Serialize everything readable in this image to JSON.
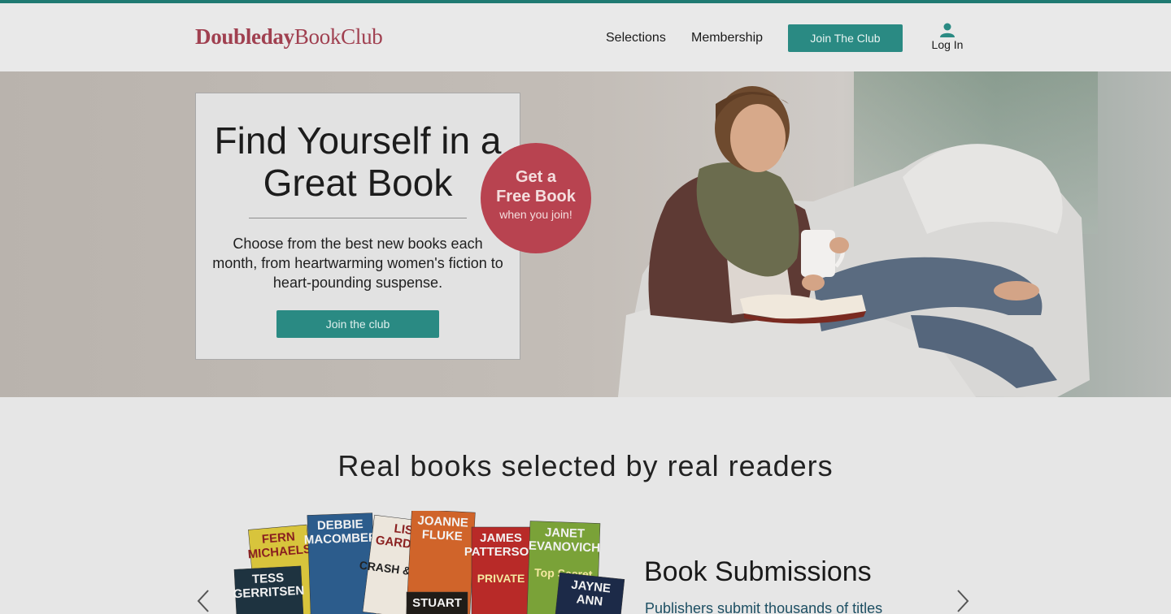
{
  "header": {
    "logo_part1": "Doubleday",
    "logo_part2": "BookClub",
    "nav": {
      "selections": "Selections",
      "membership": "Membership"
    },
    "join_button": "Join The Club",
    "login_label": "Log In"
  },
  "hero": {
    "headline": "Find Yourself in a Great Book",
    "description": "Choose from the best new books each month, from heartwarming women's fiction to heart-pounding suspense.",
    "join_button": "Join the club",
    "badge": {
      "line1": "Get a",
      "line2": "Free Book",
      "line3": "when you join!"
    }
  },
  "section": {
    "title": "Real books selected by real readers",
    "submissions_title": "Book Submissions",
    "submissions_text": "Publishers submit thousands of titles"
  },
  "books": [
    {
      "author": "FERN MICHAELS",
      "color": "#d8c43c"
    },
    {
      "author": "TESS GERRITSEN",
      "color": "#1e3340"
    },
    {
      "author": "DEBBIE MACOMBER",
      "color": "#2c5c8c"
    },
    {
      "author": "LISA GARDNER",
      "title": "CRASH & BURN",
      "color": "#ece6dc"
    },
    {
      "author": "JOANNE FLUKE",
      "color": "#d0642a"
    },
    {
      "author": "JAMES PATTERSON",
      "title": "PRIVATE",
      "color": "#b82a28"
    },
    {
      "author": "JANET EVANOVICH",
      "title": "Top Secret",
      "color": "#7aa238"
    },
    {
      "author": "JAYNE ANN",
      "color": "#1c2a48"
    },
    {
      "author": "STUART",
      "color": "#201c18"
    }
  ],
  "colors": {
    "brand": "#a04050",
    "accent_teal": "#2a8a83",
    "badge_red": "#b84350",
    "link_blue": "#1d4f63"
  },
  "icons": {
    "login": "person-icon",
    "prev": "chevron-left-icon",
    "next": "chevron-right-icon"
  }
}
